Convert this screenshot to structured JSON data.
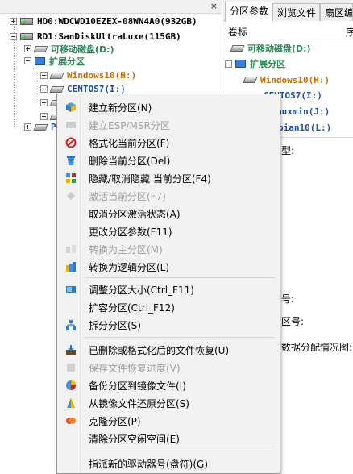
{
  "tree": {
    "close_glyph": "×",
    "disks": [
      {
        "label": "HD0:WDCWD10EZEX-08WN4A0(932GB)"
      },
      {
        "label": "RD1:SanDiskUltraLuxe(115GB)"
      }
    ],
    "nodes": [
      {
        "label": "可移动磁盘(D:)",
        "color": "#2e8b57"
      },
      {
        "label": "扩展分区",
        "color": "#2e8b57"
      },
      {
        "label": "Windows10(H:)",
        "color": "#c96a00"
      },
      {
        "label": "CENTOS7(I:)",
        "color": "#1a4fa0"
      },
      {
        "label": "P",
        "color": "#1a4fa0"
      }
    ]
  },
  "right_panel": {
    "tabs": [
      "分区参数",
      "浏览文件",
      "扇区编"
    ],
    "column_header": "卷标",
    "column_header_2": "序",
    "rows": [
      {
        "label": "可移动磁盘(D:)",
        "color": "#2e8b57"
      },
      {
        "label": "扩展分区",
        "color": "#2e8b57"
      },
      {
        "label": "Windows10(H:)",
        "color": "#c96a00"
      },
      {
        "label": "CENTOS7(I:)",
        "color": "#1a4fa0"
      },
      {
        "label": "auxmin(J:)",
        "color": "#1a4fa0"
      },
      {
        "label": "bian10(L:)",
        "color": "#1a4fa0"
      }
    ],
    "side_labels": [
      "型:",
      "号:",
      "区号:",
      "数据分配情况图:"
    ]
  },
  "menu": {
    "items": [
      {
        "label": "建立新分区(N)",
        "icon": "new-partition-icon",
        "disabled": false
      },
      {
        "label": "建立ESP/MSR分区",
        "icon": "esp-msr-icon",
        "disabled": true
      },
      {
        "label": "格式化当前分区(F)",
        "icon": "format-icon",
        "disabled": false
      },
      {
        "label": "删除当前分区(Del)",
        "icon": "trash-icon",
        "disabled": false
      },
      {
        "label": "隐藏/取消隐藏 当前分区(F4)",
        "icon": "hide-icon",
        "disabled": false
      },
      {
        "label": "激活当前分区(F7)",
        "icon": "activate-icon",
        "disabled": true
      },
      {
        "label": "取消分区激活状态(A)",
        "icon": "",
        "disabled": false
      },
      {
        "label": "更改分区参数(F11)",
        "icon": "",
        "disabled": false
      },
      {
        "label": "转换为主分区(M)",
        "icon": "convert-primary-icon",
        "disabled": true
      },
      {
        "label": "转换为逻辑分区(L)",
        "icon": "convert-logical-icon",
        "disabled": false
      },
      {
        "label": "调整分区大小(Ctrl_F11)",
        "icon": "resize-icon",
        "disabled": false
      },
      {
        "label": "扩容分区(Ctrl_F12)",
        "icon": "",
        "disabled": false
      },
      {
        "label": "拆分分区(S)",
        "icon": "split-icon",
        "disabled": false
      },
      {
        "label": "已删除或格式化后的文件恢复(U)",
        "icon": "recover-icon",
        "disabled": false
      },
      {
        "label": "保存文件恢复进度(V)",
        "icon": "save-progress-icon",
        "disabled": true
      },
      {
        "label": "备份分区到镜像文件(I)",
        "icon": "backup-icon",
        "disabled": false
      },
      {
        "label": "从镜像文件还原分区(S)",
        "icon": "restore-icon",
        "disabled": false
      },
      {
        "label": "克隆分区(P)",
        "icon": "clone-icon",
        "disabled": false
      },
      {
        "label": "清除分区空闲空间(E)",
        "icon": "",
        "disabled": false
      },
      {
        "label": "指派新的驱动器号(盘符)(G)",
        "icon": "",
        "disabled": false
      }
    ]
  }
}
